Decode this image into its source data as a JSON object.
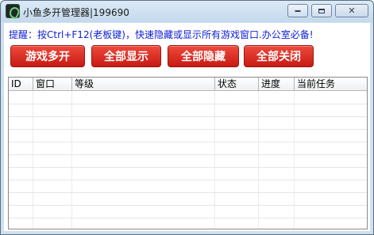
{
  "window": {
    "title": "小鱼多开管理器|199690",
    "icon": "fish-app-icon",
    "controls": {
      "minimize_icon": "minimize-icon",
      "maximize_icon": "maximize-icon",
      "close_label": "✕"
    }
  },
  "hint": "提醒：按Ctrl+F12(老板键)，快速隐藏或显示所有游戏窗口.办公室必备!",
  "buttons": {
    "multi_open": "游戏多开",
    "show_all": "全部显示",
    "hide_all": "全部隐藏",
    "close_all": "全部关闭"
  },
  "table": {
    "columns": [
      "ID",
      "窗口",
      "等级",
      "状态",
      "进度",
      "当前任务"
    ],
    "rows": []
  },
  "colors": {
    "button_red": "#d62b20",
    "hint_blue": "#1020d8",
    "titlebar": "#cfe0f0"
  }
}
